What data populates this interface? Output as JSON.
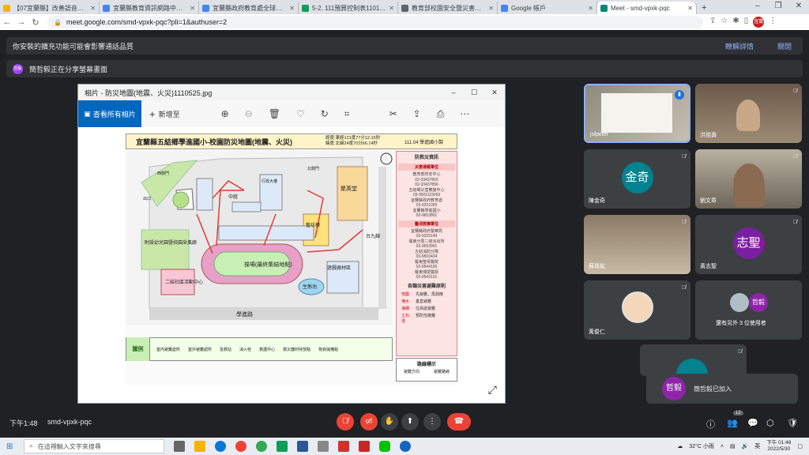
{
  "browser": {
    "tabs": [
      {
        "label": "【07宜蘭縣】改善語音暢通好聲...",
        "color": "#f4b400"
      },
      {
        "label": "宜蘭縣教育資訊網路中心 - 數位...",
        "color": "#4285f4"
      },
      {
        "label": "宜蘭縣政府教育處全球資訊網",
        "color": "#4285f4"
      },
      {
        "label": "5-2. 111預算控制表1101122(...",
        "color": "#0f9d58"
      },
      {
        "label": "教育部校園安全暨災害防救通報...",
        "color": "#5f6368"
      },
      {
        "label": "Google 帳戶",
        "color": "#4285f4"
      },
      {
        "label": "Meet - smd-vpxk-pqc",
        "color": "#00897b"
      }
    ],
    "url": "meet.google.com/smd-vpxk-pqc?pli=1&authuser=2",
    "profile": "宜蘭"
  },
  "notices": {
    "extension": "你安裝的擴充功能可能會影響通話品質",
    "details": "瞭解詳情",
    "close": "關閉",
    "presenting_avatar": "哲毅",
    "presenting": "簡哲毅正在分享螢幕畫面"
  },
  "photos_app": {
    "title": "相片 - 防災地圖(地震、火災)1110525.jpg",
    "view_all": "查看所有相片",
    "add_to": "新增至"
  },
  "map": {
    "title": "宜蘭縣五結鄉學進國小-校園防災地圖(地震、火災)",
    "coords_line1": "經度:東經121度77分12.16秒",
    "coords_line2": "緯度:北緯24度70分66.14秒",
    "date": "111.04 學進國小製",
    "campus_labels": {
      "playground": "操場(最終集結地點)",
      "kindergarten": "附設幼兒園暨校園采風廊",
      "community": "二結社區活動中心",
      "ecopool": "生態池",
      "play": "遊戲器材區",
      "hall": "聚英堂",
      "library": "藝坊樓",
      "road": "學進路",
      "road_east": "台九線",
      "guard": "中庭",
      "building": "行政大樓",
      "north_gate": "北側門",
      "west_gate": "西側門",
      "exit": "出口"
    },
    "info_title": "防救災資訊",
    "disaster_unit": "災害通報單位",
    "disaster_lines": [
      "教育部校安中心",
      "02-33437855",
      "02-33437856",
      "五結鄉災害應變中心",
      "03-9501115#63",
      "宜蘭縣政府教育處",
      "03-9251000",
      "宜蘭縣學進國小",
      "03-9653801"
    ],
    "medical_unit": "醫消救療單位",
    "medical_lines": [
      "宜蘭縣政府警察局",
      "03-9325149",
      "羅東分局二結派出所",
      "03-9653901",
      "五結消防分隊",
      "03-9503434",
      "羅東聖母醫院",
      "03-9544106",
      "羅東博愛醫院",
      "03-9543131"
    ],
    "rules_title": "各類災害避難原則",
    "rules": [
      {
        "k": "地震",
        "v": "先避難，再疏散"
      },
      {
        "k": "淹水",
        "v": "垂直避難"
      },
      {
        "k": "海嘯",
        "v": "往高處避難"
      },
      {
        "k": "土石流",
        "v": "預防性撤離"
      }
    ],
    "legend_title": "圖例",
    "legend_items": [
      "室內避難處所",
      "室外避難處所",
      "急救站",
      "消火栓",
      "救護中心",
      "救災器材存放點",
      "物資儲備點",
      "通訊設備",
      "避難路線"
    ],
    "route_title": "路線標示",
    "route_items": [
      "避難方向",
      "避難路線"
    ]
  },
  "participants": [
    {
      "name": "jsfpeter",
      "type": "photo",
      "mic": "active"
    },
    {
      "name": "洪祖壽",
      "type": "photo"
    },
    {
      "name": "陳金奇",
      "avatar": "金奇",
      "color": "#00838f"
    },
    {
      "name": "劉文章",
      "type": "photo"
    },
    {
      "name": "蘇珠紘",
      "type": "photo"
    },
    {
      "name": "黃志聖",
      "avatar": "志聖",
      "color": "#7b1fa2"
    },
    {
      "name": "黃俊仁",
      "type": "photo"
    },
    {
      "name": "還有另外 3 位使用者",
      "avatar": "哲毅",
      "color": "#8e24aa"
    }
  ],
  "toast": {
    "avatar": "哲毅",
    "text": "簡哲毅已加入"
  },
  "meeting": {
    "time": "下午1:48",
    "code": "smd-vpxk-pqc",
    "people_count": "12"
  },
  "taskbar": {
    "search_placeholder": "在這裡輸入文字來搜尋",
    "weather": "32°C 小雨",
    "lang": "英",
    "time": "下午 01:48",
    "date": "2022/5/30"
  },
  "colors": {
    "accent": "#0067c0",
    "leave": "#ea4335",
    "meet_bg": "#202124"
  }
}
